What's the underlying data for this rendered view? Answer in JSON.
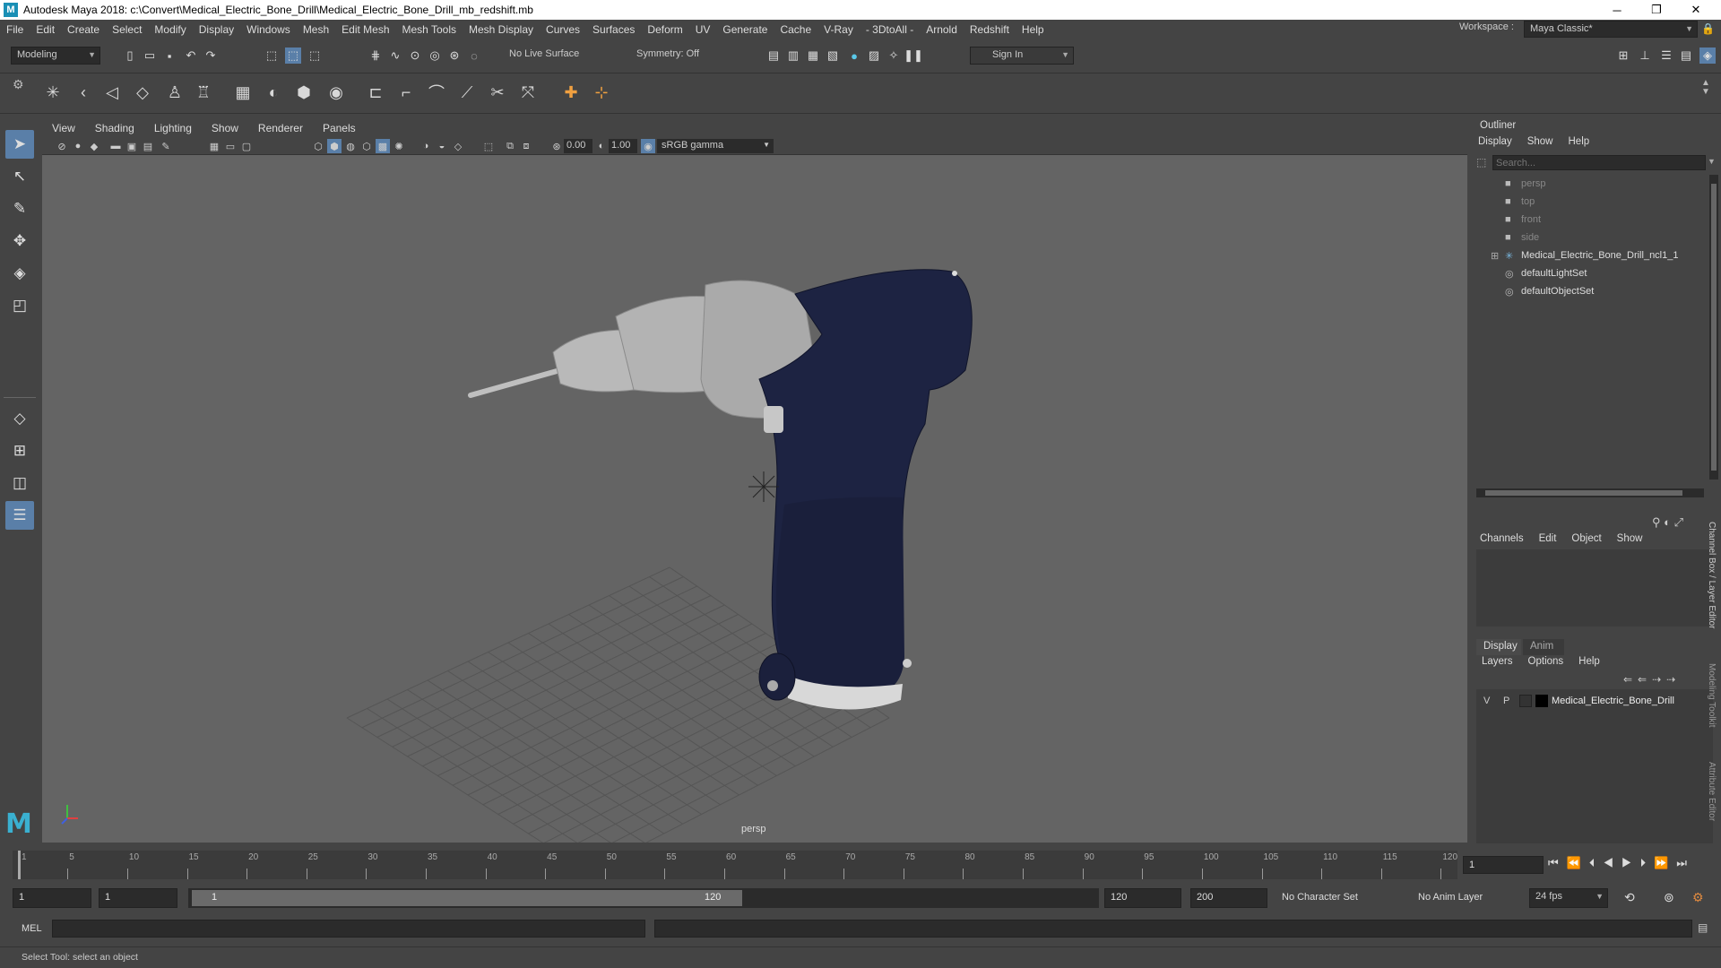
{
  "window": {
    "title": "Autodesk Maya 2018: c:\\Convert\\Medical_Electric_Bone_Drill\\Medical_Electric_Bone_Drill_mb_redshift.mb",
    "minimize": "─",
    "maximize": "❐",
    "close": "✕"
  },
  "menus": [
    "File",
    "Edit",
    "Create",
    "Select",
    "Modify",
    "Display",
    "Windows",
    "Mesh",
    "Edit Mesh",
    "Mesh Tools",
    "Mesh Display",
    "Curves",
    "Surfaces",
    "Deform",
    "UV",
    "Generate",
    "Cache",
    "V-Ray",
    "- 3DtoAll -",
    "Arnold",
    "Redshift",
    "Help"
  ],
  "workspace": {
    "label": "Workspace :",
    "value": "Maya Classic*"
  },
  "statusline": {
    "mode": "Modeling",
    "live_surface": "No Live Surface",
    "symmetry": "Symmetry: Off",
    "sign_in": "Sign In"
  },
  "viewport": {
    "menus": [
      "View",
      "Shading",
      "Lighting",
      "Show",
      "Renderer",
      "Panels"
    ],
    "exposure": "0.00",
    "gamma": "1.00",
    "color_space": "sRGB gamma",
    "camera_label": "persp"
  },
  "outliner": {
    "title": "Outliner",
    "menus": [
      "Display",
      "Show",
      "Help"
    ],
    "search_placeholder": "Search...",
    "items": [
      {
        "label": "persp",
        "type": "camera",
        "dim": true
      },
      {
        "label": "top",
        "type": "camera",
        "dim": true
      },
      {
        "label": "front",
        "type": "camera",
        "dim": true
      },
      {
        "label": "side",
        "type": "camera",
        "dim": true
      },
      {
        "label": "Medical_Electric_Bone_Drill_ncl1_1",
        "type": "group",
        "dim": false
      },
      {
        "label": "defaultLightSet",
        "type": "set",
        "dim": false
      },
      {
        "label": "defaultObjectSet",
        "type": "set",
        "dim": false
      }
    ]
  },
  "channelbox": {
    "menus": [
      "Channels",
      "Edit",
      "Object",
      "Show"
    ],
    "tabs": [
      "Display",
      "Anim"
    ],
    "layer_menus": [
      "Layers",
      "Options",
      "Help"
    ],
    "layer": {
      "v": "V",
      "p": "P",
      "name": "Medical_Electric_Bone_Drill"
    }
  },
  "side_tabs": [
    "Channel Box / Layer Editor",
    "Modeling Toolkit",
    "Attribute Editor"
  ],
  "timeline": {
    "ticks": [
      "1",
      "5",
      "10",
      "15",
      "20",
      "25",
      "30",
      "35",
      "40",
      "45",
      "50",
      "55",
      "60",
      "65",
      "70",
      "75",
      "80",
      "85",
      "90",
      "95",
      "100",
      "105",
      "110",
      "115",
      "120"
    ],
    "current_frame": "1",
    "range_start": "1",
    "playback_start": "1",
    "range_slider_start": "1",
    "range_slider_end": "120",
    "playback_end": "120",
    "range_end": "200",
    "character_set": "No Character Set",
    "anim_layer": "No Anim Layer",
    "fps": "24 fps"
  },
  "command_line": {
    "label": "MEL"
  },
  "help_line": "Select Tool: select an object",
  "colors": {
    "viewport_bg": "#646464",
    "drill_body": "#1c2240",
    "chuck": "#b5b5b5"
  }
}
